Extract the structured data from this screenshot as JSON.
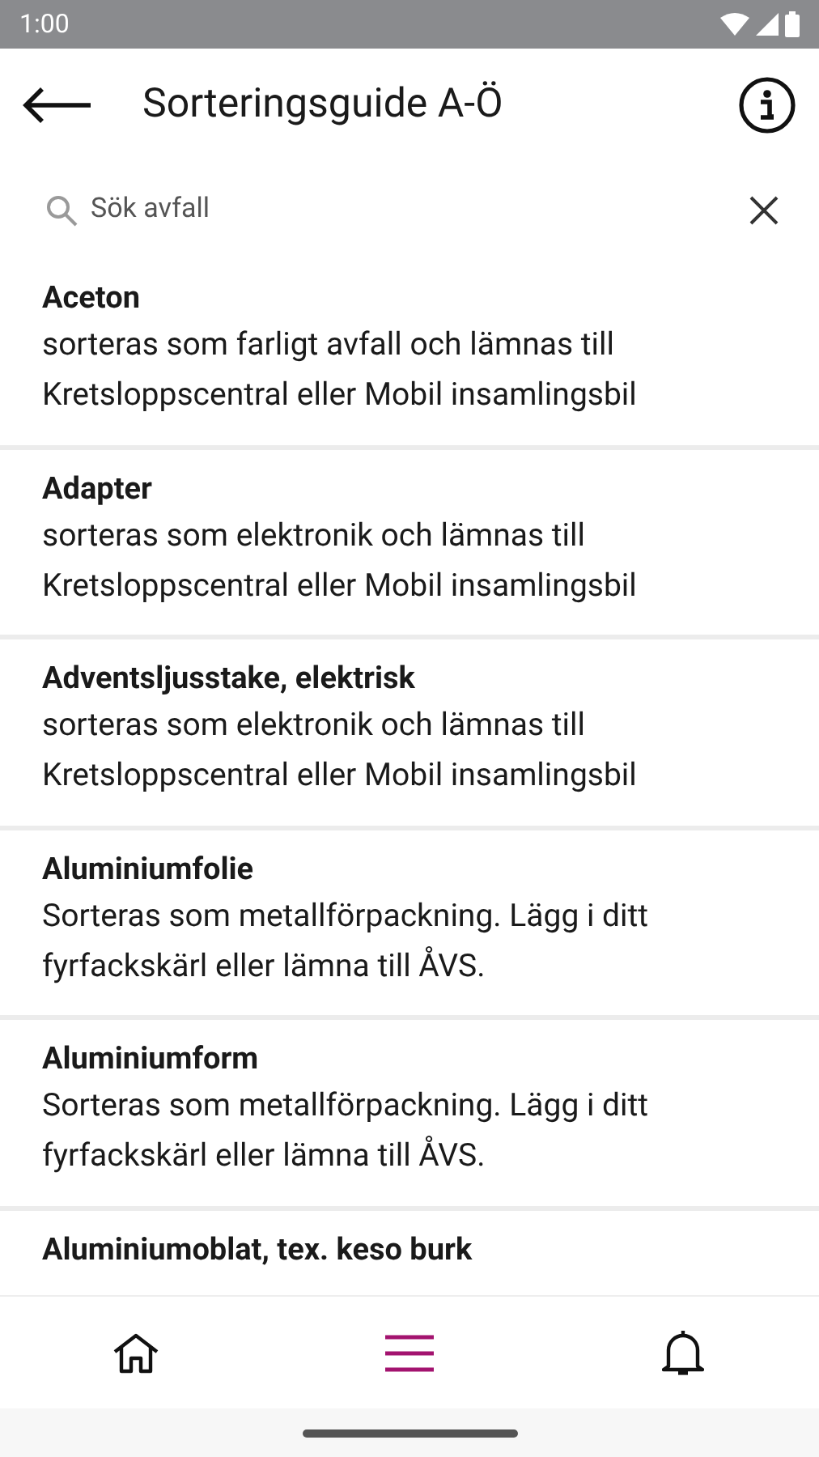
{
  "status_bar": {
    "time": "1:00"
  },
  "app_bar": {
    "title": "Sorteringsguide A-Ö"
  },
  "search": {
    "placeholder": "Sök avfall"
  },
  "items": [
    {
      "title": "Aceton",
      "description": "sorteras som farligt avfall och lämnas till Kretsloppscentral eller Mobil insamlingsbil"
    },
    {
      "title": "Adapter",
      "description": "sorteras som elektronik och lämnas till Kretsloppscentral eller Mobil insamlingsbil"
    },
    {
      "title": "Adventsljusstake, elektrisk",
      "description": "sorteras som elektronik och lämnas till Kretsloppscentral eller Mobil insamlingsbil"
    },
    {
      "title": "Aluminiumfolie",
      "description": "Sorteras som metallförpackning. Lägg i ditt fyrfackskärl eller lämna till ÅVS."
    },
    {
      "title": "Aluminiumform",
      "description": "Sorteras som metallförpackning. Lägg i ditt fyrfackskärl eller lämna till ÅVS."
    },
    {
      "title": "Aluminiumoblat, tex. keso burk"
    }
  ],
  "nav": [
    {
      "kind": "home",
      "selected": false
    },
    {
      "kind": "menu",
      "selected": true
    },
    {
      "kind": "bell",
      "selected": false
    }
  ]
}
